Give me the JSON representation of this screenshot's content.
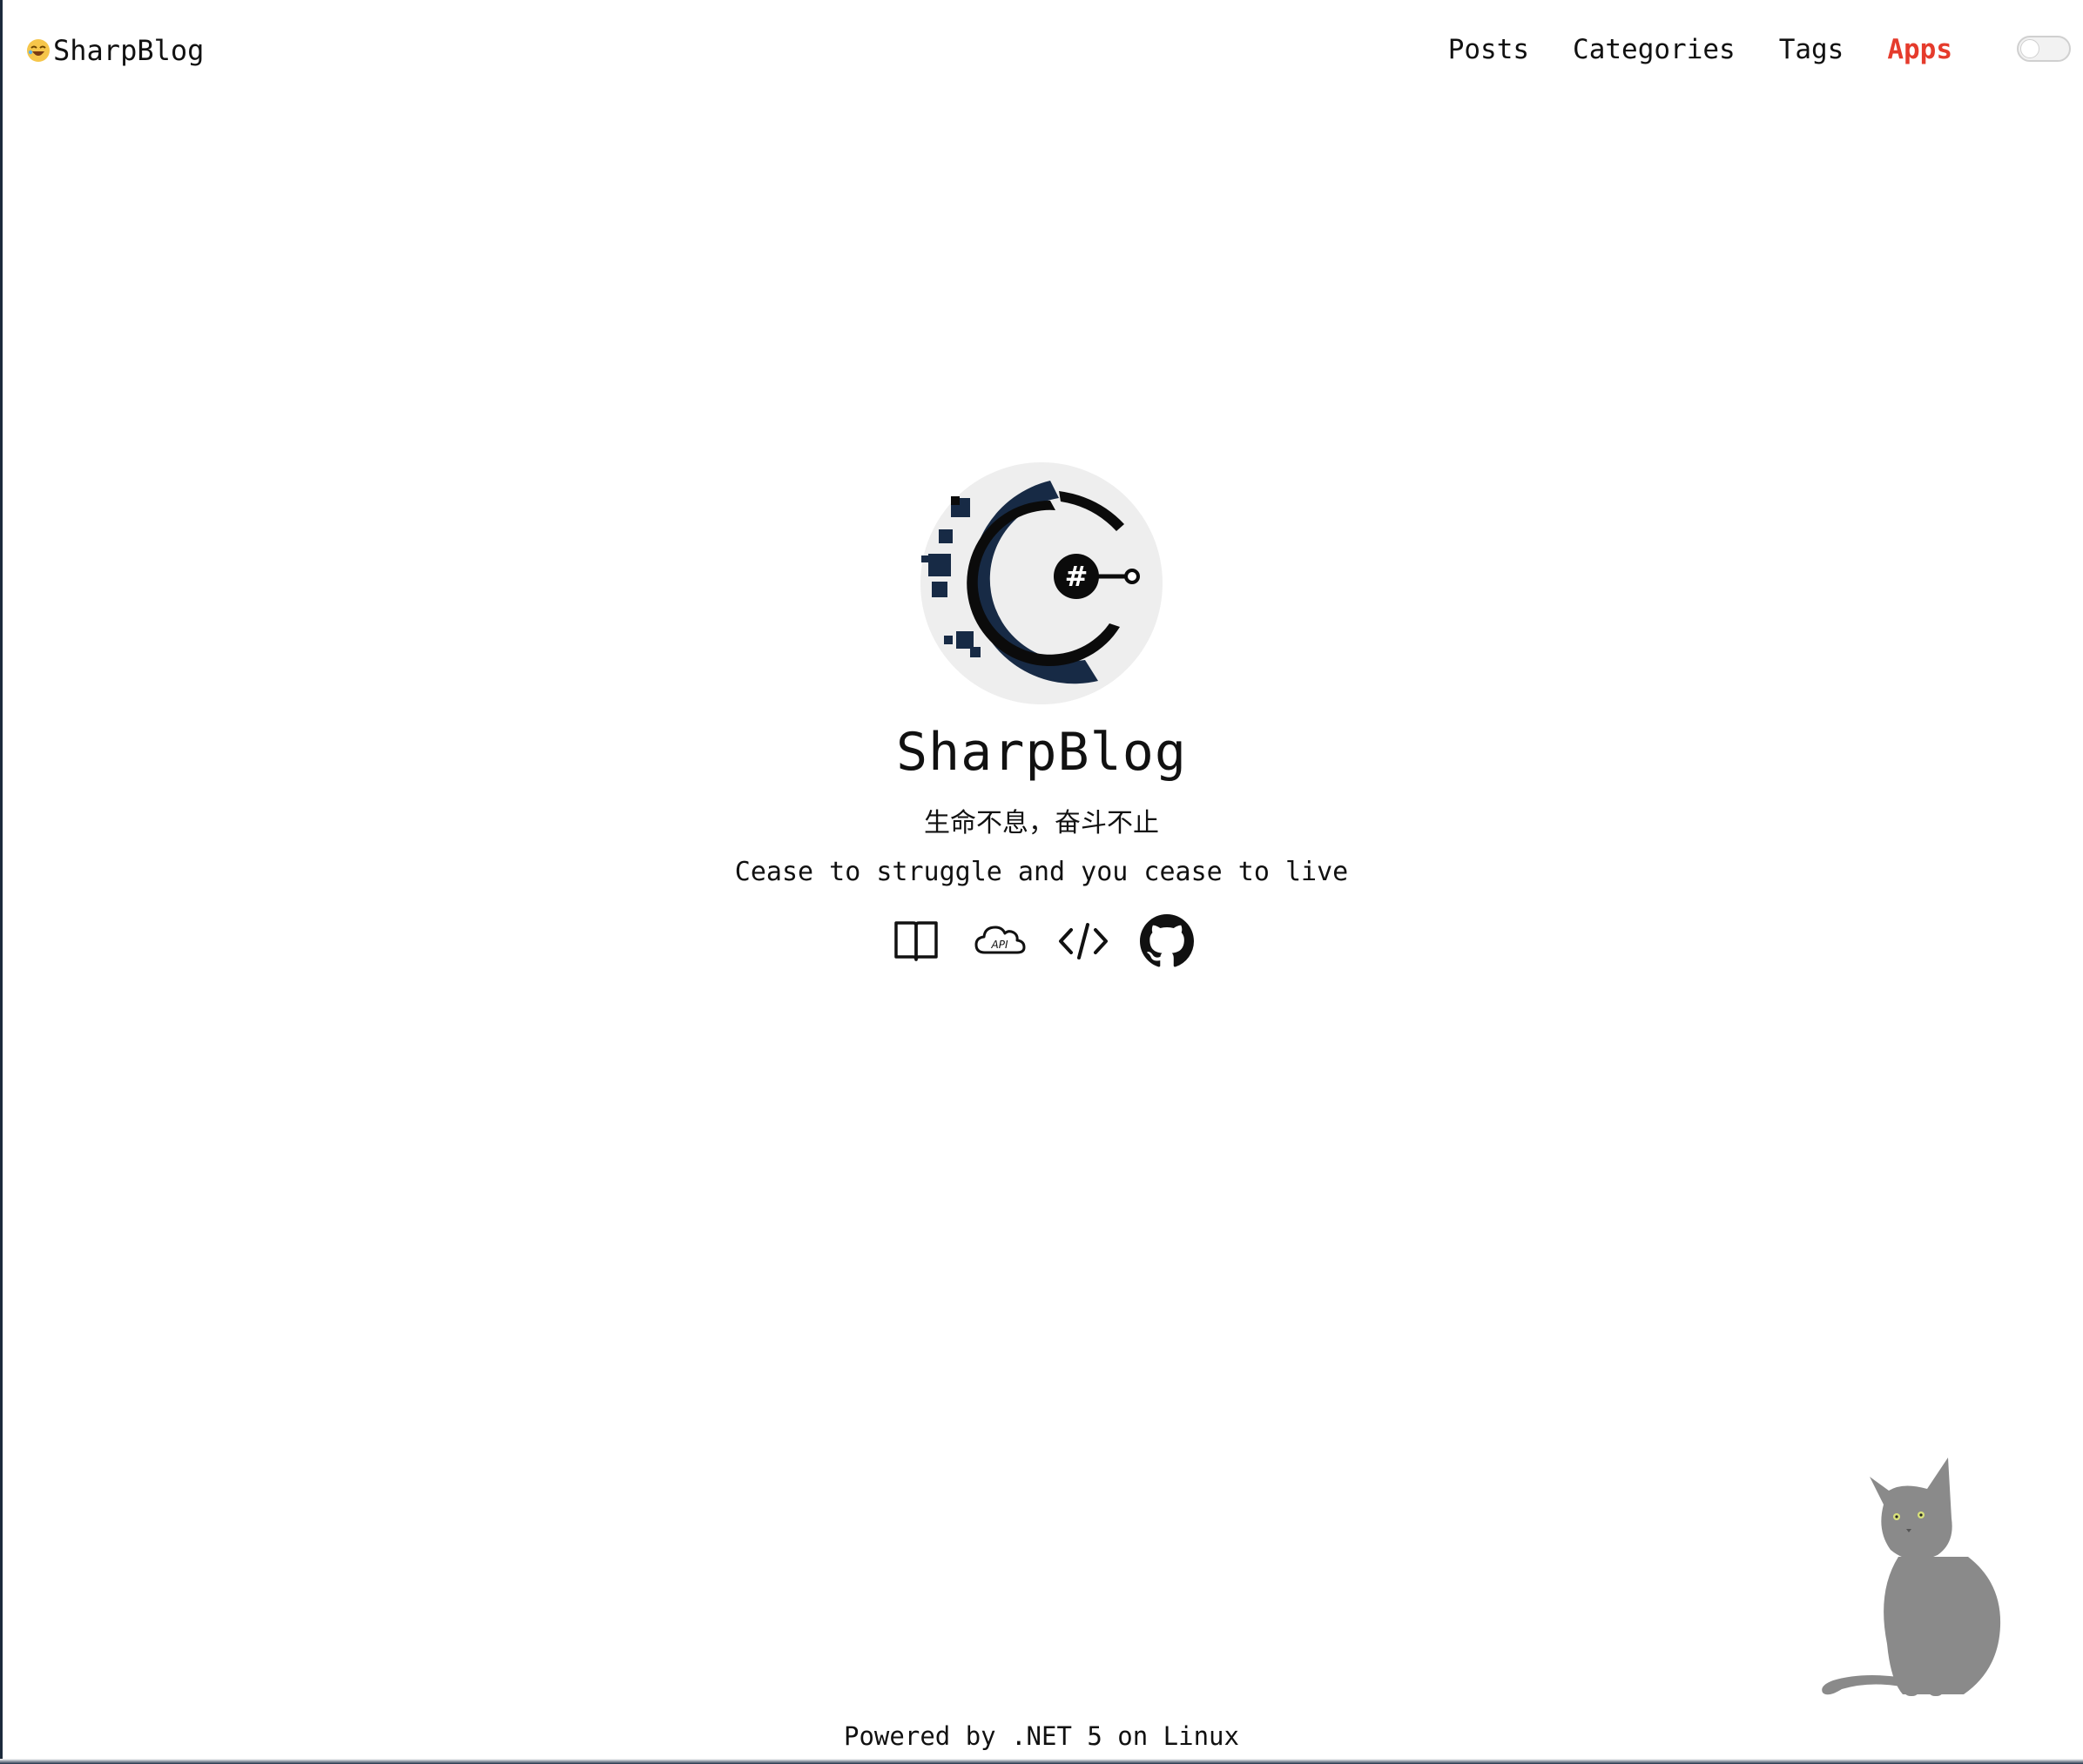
{
  "header": {
    "brand_emoji": "laughing-face-emoji",
    "brand_label": "SharpBlog",
    "nav": [
      {
        "label": "Posts",
        "active": false
      },
      {
        "label": "Categories",
        "active": false
      },
      {
        "label": "Tags",
        "active": false
      },
      {
        "label": "Apps",
        "active": true
      }
    ],
    "theme_toggle": {
      "on": false
    },
    "accent_color": "#e53b2c"
  },
  "hero": {
    "avatar": "csharp-logo-avatar",
    "title": "SharpBlog",
    "motto_cn": "生命不息，奋斗不止",
    "motto_en": "Cease to struggle and you cease to live",
    "links": [
      {
        "icon": "book-icon"
      },
      {
        "icon": "cloud-api-icon",
        "glyph_text": "API"
      },
      {
        "icon": "code-icon"
      },
      {
        "icon": "github-icon"
      }
    ]
  },
  "decoration": {
    "mascot": "cat-illustration"
  },
  "footer": {
    "text": "Powered by .NET 5 on Linux"
  }
}
